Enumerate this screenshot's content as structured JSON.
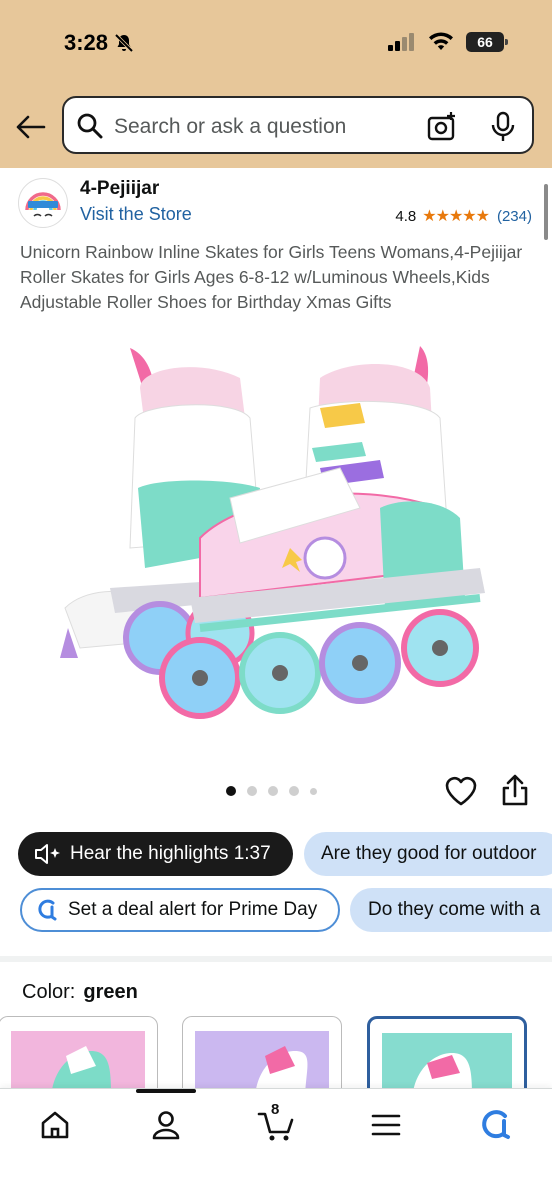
{
  "status": {
    "time": "3:28",
    "battery": "66"
  },
  "search": {
    "placeholder": "Search or ask a question"
  },
  "store": {
    "brand": "4-Pejiijar",
    "visit_label": "Visit the Store",
    "rating": "4.8",
    "stars": "★★★★★",
    "rating_count": "(234)"
  },
  "product": {
    "title": "Unicorn Rainbow Inline Skates for Girls Teens Womans,4-Pejiijar Roller Skates for Girls Ages 6-8-12 w/Luminous Wheels,Kids Adjustable Roller Shoes for Birthday Xmas Gifts",
    "image_count": 5,
    "active_image": 1
  },
  "chips": {
    "highlights": "Hear the highlights 1:37",
    "question1": "Are they good for outdoor",
    "deal_alert": "Set a deal alert for Prime Day",
    "question2": "Do they come with a"
  },
  "variation": {
    "label": "Color:",
    "value": "green",
    "swatch_colors": [
      "#f2b6dd",
      "#cbb8f0",
      "#86dccf"
    ],
    "selected_index": 2
  },
  "nav": {
    "cart_count": "8",
    "items": [
      "home-icon",
      "account-icon",
      "cart-icon",
      "menu-icon",
      "rufus-icon"
    ]
  },
  "colors": {
    "header_bg": "#e7c79a",
    "link": "#2162a1",
    "star": "#e8790c",
    "chip_blue": "#cfe1f7",
    "chip_dark": "#1a1a1a"
  }
}
